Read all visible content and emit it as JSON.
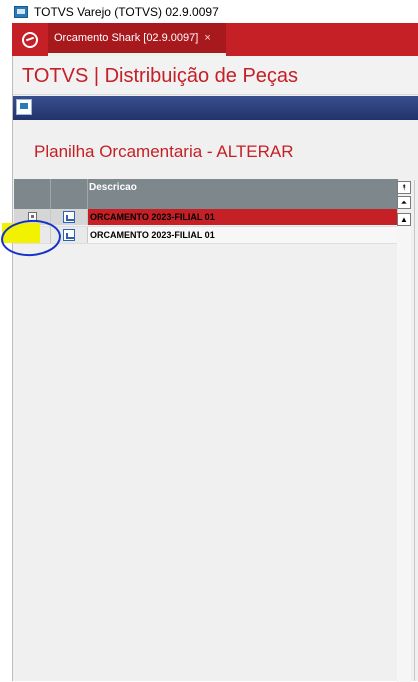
{
  "window": {
    "title": "TOTVS Varejo (TOTVS) 02.9.0097"
  },
  "tabs": [
    {
      "label": "Orcamento Shark [02.9.0097]",
      "close": "×"
    }
  ],
  "app": {
    "title": "TOTVS | Distribuição de Peças"
  },
  "page": {
    "title": "Planilha Orcamentaria - ALTERAR"
  },
  "grid": {
    "columns": [
      "",
      "",
      "Descricao"
    ],
    "rows": [
      {
        "descricao": "ORCAMENTO 2023-FILIAL 01",
        "selected": true
      },
      {
        "descricao": "ORCAMENTO 2023-FILIAL 01",
        "selected": false
      }
    ]
  },
  "scroll": {
    "top": "⯭",
    "page_up": "⏶",
    "up": "▲"
  },
  "colors": {
    "accent": "#c42026",
    "header": "#7e878c",
    "toolbar": "#22336b",
    "highlight": "#f2f200",
    "annotation": "#1533c9"
  }
}
